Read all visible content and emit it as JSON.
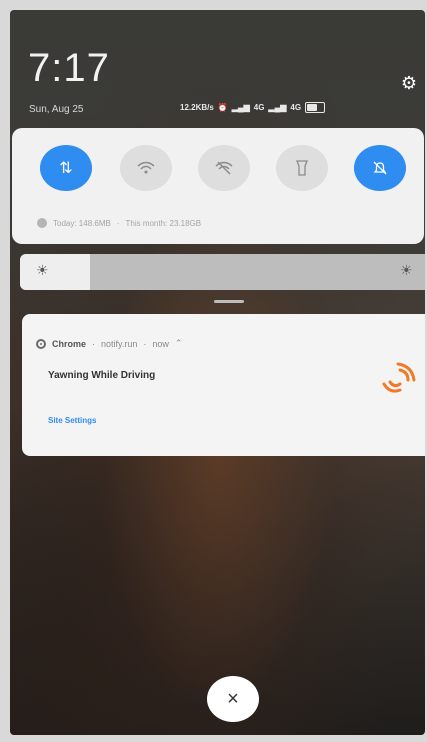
{
  "lockscreen": {
    "time": "7:17",
    "date": "Sun, Aug 25",
    "settings_icon": "gear-icon"
  },
  "status_bar": {
    "speed": "12.2KB/s",
    "signal1": "4G",
    "signal2": "4G",
    "battery_icon": "battery-icon"
  },
  "quick_settings": {
    "toggles": [
      {
        "name": "mobile-data",
        "icon": "⇅",
        "state": "on"
      },
      {
        "name": "wifi",
        "icon": "wifi-icon",
        "state": "off"
      },
      {
        "name": "hotspot",
        "icon": "hotspot-icon",
        "state": "off"
      },
      {
        "name": "flashlight",
        "icon": "flashlight-icon",
        "state": "off"
      },
      {
        "name": "do-not-disturb",
        "icon": "bell-off-icon",
        "state": "on"
      }
    ],
    "data_usage_today": "Today: 148.6MB",
    "data_usage_month": "This month: 23.18GB"
  },
  "brightness": {
    "level_fraction": 0.17
  },
  "notification": {
    "app_name": "Chrome",
    "source": "notify.run",
    "time": "now",
    "title": "Yawning While Driving",
    "action_label": "Site Settings",
    "accent_color": "#f07a2a"
  },
  "dismiss": {
    "close_symbol": "×"
  },
  "colors": {
    "accent_blue": "#2f8cf0",
    "panel_bg": "#f1f1f1"
  }
}
